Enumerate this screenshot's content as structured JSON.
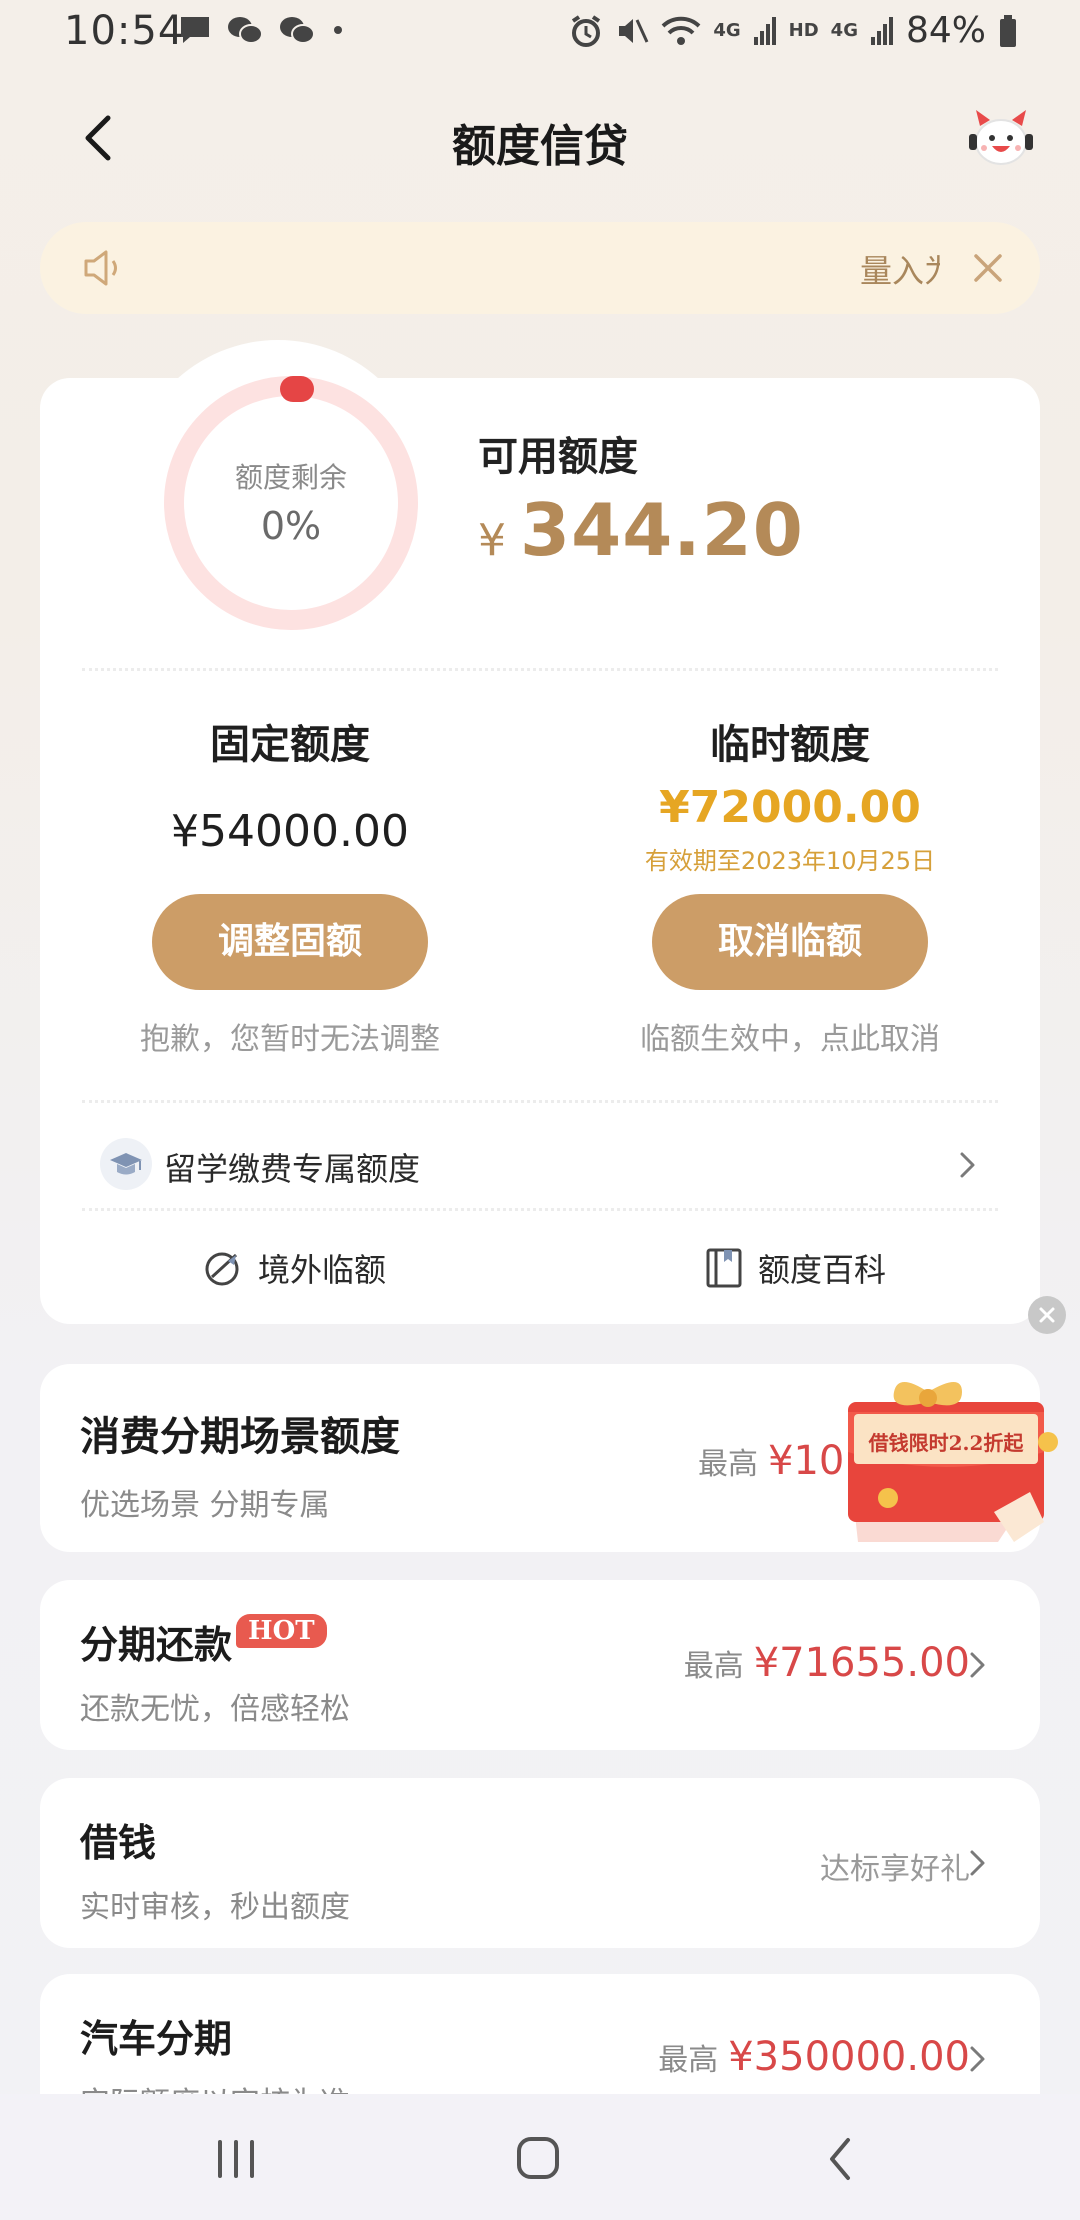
{
  "status_bar": {
    "time": "10:54",
    "battery": "84%",
    "network_labels": [
      "4G",
      "HD",
      "4G"
    ],
    "icons": [
      "message-icon",
      "wechat-icon",
      "wechat-icon",
      "dot-icon",
      "alarm-icon",
      "mute-icon",
      "wifi-icon",
      "signal-icon",
      "signal-icon",
      "battery-icon"
    ]
  },
  "header": {
    "title": "额度信贷"
  },
  "notice": {
    "text": "量入为"
  },
  "quota_ring": {
    "label": "额度剩余",
    "percent": "0%",
    "remaining_fraction": 0
  },
  "available": {
    "label": "可用额度",
    "currency": "¥",
    "amount": "344.20"
  },
  "fixed_quota": {
    "title": "固定额度",
    "amount": "¥54000.00",
    "button": "调整固额",
    "note": "抱歉，您暂时无法调整"
  },
  "temp_quota": {
    "title": "临时额度",
    "amount": "¥72000.00",
    "expiry": "有效期至2023年10月25日",
    "button": "取消临额",
    "note": "临额生效中，点此取消"
  },
  "study_abroad": {
    "label": "留学缴费专属额度"
  },
  "links": {
    "overseas": "境外临额",
    "encyclopedia": "额度百科"
  },
  "consumer_card": {
    "title": "消费分期场景额度",
    "subtitle": "优选场景 分期专属",
    "prefix": "最高",
    "amount": "¥10"
  },
  "promo": {
    "text": "借钱限时2.2折起"
  },
  "list": [
    {
      "title": "分期还款",
      "badge": "HOT",
      "subtitle": "还款无忧，倍感轻松",
      "prefix": "最高",
      "amount": "¥71655.00"
    },
    {
      "title": "借钱",
      "subtitle": "实时审核，秒出额度",
      "right_text": "达标享好礼"
    },
    {
      "title": "汽车分期",
      "subtitle": "实际额度以审核为准",
      "prefix": "最高",
      "amount": "¥350000.00"
    }
  ],
  "colors": {
    "gold": "#cc9d67",
    "gold_text": "#b48a58",
    "amount_red": "#d84848",
    "temp_gold": "#e6a623",
    "ring_track": "#fde2e1",
    "ring_dot": "#e54545"
  }
}
